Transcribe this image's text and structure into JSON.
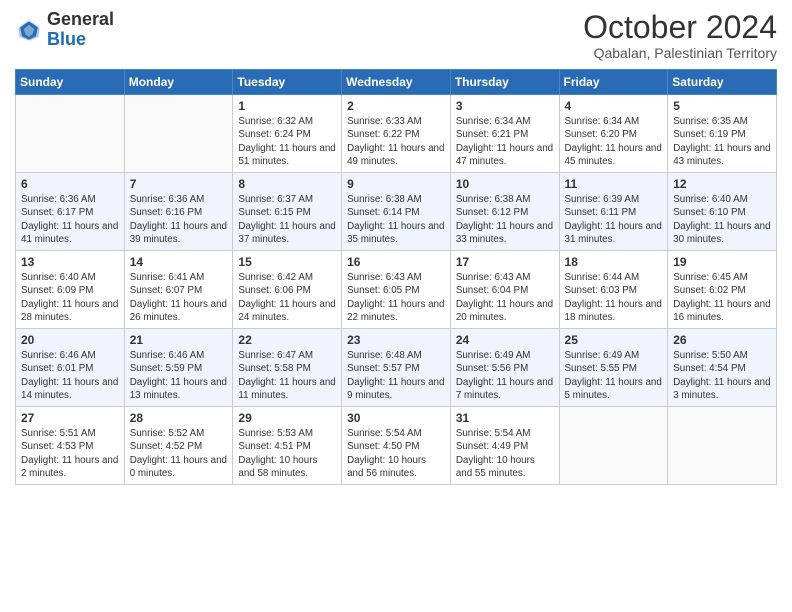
{
  "header": {
    "logo_general": "General",
    "logo_blue": "Blue",
    "month_title": "October 2024",
    "subtitle": "Qabalan, Palestinian Territory"
  },
  "weekdays": [
    "Sunday",
    "Monday",
    "Tuesday",
    "Wednesday",
    "Thursday",
    "Friday",
    "Saturday"
  ],
  "weeks": [
    [
      {
        "day": "",
        "sunrise": "",
        "sunset": "",
        "daylight": ""
      },
      {
        "day": "",
        "sunrise": "",
        "sunset": "",
        "daylight": ""
      },
      {
        "day": "1",
        "sunrise": "Sunrise: 6:32 AM",
        "sunset": "Sunset: 6:24 PM",
        "daylight": "Daylight: 11 hours and 51 minutes."
      },
      {
        "day": "2",
        "sunrise": "Sunrise: 6:33 AM",
        "sunset": "Sunset: 6:22 PM",
        "daylight": "Daylight: 11 hours and 49 minutes."
      },
      {
        "day": "3",
        "sunrise": "Sunrise: 6:34 AM",
        "sunset": "Sunset: 6:21 PM",
        "daylight": "Daylight: 11 hours and 47 minutes."
      },
      {
        "day": "4",
        "sunrise": "Sunrise: 6:34 AM",
        "sunset": "Sunset: 6:20 PM",
        "daylight": "Daylight: 11 hours and 45 minutes."
      },
      {
        "day": "5",
        "sunrise": "Sunrise: 6:35 AM",
        "sunset": "Sunset: 6:19 PM",
        "daylight": "Daylight: 11 hours and 43 minutes."
      }
    ],
    [
      {
        "day": "6",
        "sunrise": "Sunrise: 6:36 AM",
        "sunset": "Sunset: 6:17 PM",
        "daylight": "Daylight: 11 hours and 41 minutes."
      },
      {
        "day": "7",
        "sunrise": "Sunrise: 6:36 AM",
        "sunset": "Sunset: 6:16 PM",
        "daylight": "Daylight: 11 hours and 39 minutes."
      },
      {
        "day": "8",
        "sunrise": "Sunrise: 6:37 AM",
        "sunset": "Sunset: 6:15 PM",
        "daylight": "Daylight: 11 hours and 37 minutes."
      },
      {
        "day": "9",
        "sunrise": "Sunrise: 6:38 AM",
        "sunset": "Sunset: 6:14 PM",
        "daylight": "Daylight: 11 hours and 35 minutes."
      },
      {
        "day": "10",
        "sunrise": "Sunrise: 6:38 AM",
        "sunset": "Sunset: 6:12 PM",
        "daylight": "Daylight: 11 hours and 33 minutes."
      },
      {
        "day": "11",
        "sunrise": "Sunrise: 6:39 AM",
        "sunset": "Sunset: 6:11 PM",
        "daylight": "Daylight: 11 hours and 31 minutes."
      },
      {
        "day": "12",
        "sunrise": "Sunrise: 6:40 AM",
        "sunset": "Sunset: 6:10 PM",
        "daylight": "Daylight: 11 hours and 30 minutes."
      }
    ],
    [
      {
        "day": "13",
        "sunrise": "Sunrise: 6:40 AM",
        "sunset": "Sunset: 6:09 PM",
        "daylight": "Daylight: 11 hours and 28 minutes."
      },
      {
        "day": "14",
        "sunrise": "Sunrise: 6:41 AM",
        "sunset": "Sunset: 6:07 PM",
        "daylight": "Daylight: 11 hours and 26 minutes."
      },
      {
        "day": "15",
        "sunrise": "Sunrise: 6:42 AM",
        "sunset": "Sunset: 6:06 PM",
        "daylight": "Daylight: 11 hours and 24 minutes."
      },
      {
        "day": "16",
        "sunrise": "Sunrise: 6:43 AM",
        "sunset": "Sunset: 6:05 PM",
        "daylight": "Daylight: 11 hours and 22 minutes."
      },
      {
        "day": "17",
        "sunrise": "Sunrise: 6:43 AM",
        "sunset": "Sunset: 6:04 PM",
        "daylight": "Daylight: 11 hours and 20 minutes."
      },
      {
        "day": "18",
        "sunrise": "Sunrise: 6:44 AM",
        "sunset": "Sunset: 6:03 PM",
        "daylight": "Daylight: 11 hours and 18 minutes."
      },
      {
        "day": "19",
        "sunrise": "Sunrise: 6:45 AM",
        "sunset": "Sunset: 6:02 PM",
        "daylight": "Daylight: 11 hours and 16 minutes."
      }
    ],
    [
      {
        "day": "20",
        "sunrise": "Sunrise: 6:46 AM",
        "sunset": "Sunset: 6:01 PM",
        "daylight": "Daylight: 11 hours and 14 minutes."
      },
      {
        "day": "21",
        "sunrise": "Sunrise: 6:46 AM",
        "sunset": "Sunset: 5:59 PM",
        "daylight": "Daylight: 11 hours and 13 minutes."
      },
      {
        "day": "22",
        "sunrise": "Sunrise: 6:47 AM",
        "sunset": "Sunset: 5:58 PM",
        "daylight": "Daylight: 11 hours and 11 minutes."
      },
      {
        "day": "23",
        "sunrise": "Sunrise: 6:48 AM",
        "sunset": "Sunset: 5:57 PM",
        "daylight": "Daylight: 11 hours and 9 minutes."
      },
      {
        "day": "24",
        "sunrise": "Sunrise: 6:49 AM",
        "sunset": "Sunset: 5:56 PM",
        "daylight": "Daylight: 11 hours and 7 minutes."
      },
      {
        "day": "25",
        "sunrise": "Sunrise: 6:49 AM",
        "sunset": "Sunset: 5:55 PM",
        "daylight": "Daylight: 11 hours and 5 minutes."
      },
      {
        "day": "26",
        "sunrise": "Sunrise: 5:50 AM",
        "sunset": "Sunset: 4:54 PM",
        "daylight": "Daylight: 11 hours and 3 minutes."
      }
    ],
    [
      {
        "day": "27",
        "sunrise": "Sunrise: 5:51 AM",
        "sunset": "Sunset: 4:53 PM",
        "daylight": "Daylight: 11 hours and 2 minutes."
      },
      {
        "day": "28",
        "sunrise": "Sunrise: 5:52 AM",
        "sunset": "Sunset: 4:52 PM",
        "daylight": "Daylight: 11 hours and 0 minutes."
      },
      {
        "day": "29",
        "sunrise": "Sunrise: 5:53 AM",
        "sunset": "Sunset: 4:51 PM",
        "daylight": "Daylight: 10 hours and 58 minutes."
      },
      {
        "day": "30",
        "sunrise": "Sunrise: 5:54 AM",
        "sunset": "Sunset: 4:50 PM",
        "daylight": "Daylight: 10 hours and 56 minutes."
      },
      {
        "day": "31",
        "sunrise": "Sunrise: 5:54 AM",
        "sunset": "Sunset: 4:49 PM",
        "daylight": "Daylight: 10 hours and 55 minutes."
      },
      {
        "day": "",
        "sunrise": "",
        "sunset": "",
        "daylight": ""
      },
      {
        "day": "",
        "sunrise": "",
        "sunset": "",
        "daylight": ""
      }
    ]
  ]
}
